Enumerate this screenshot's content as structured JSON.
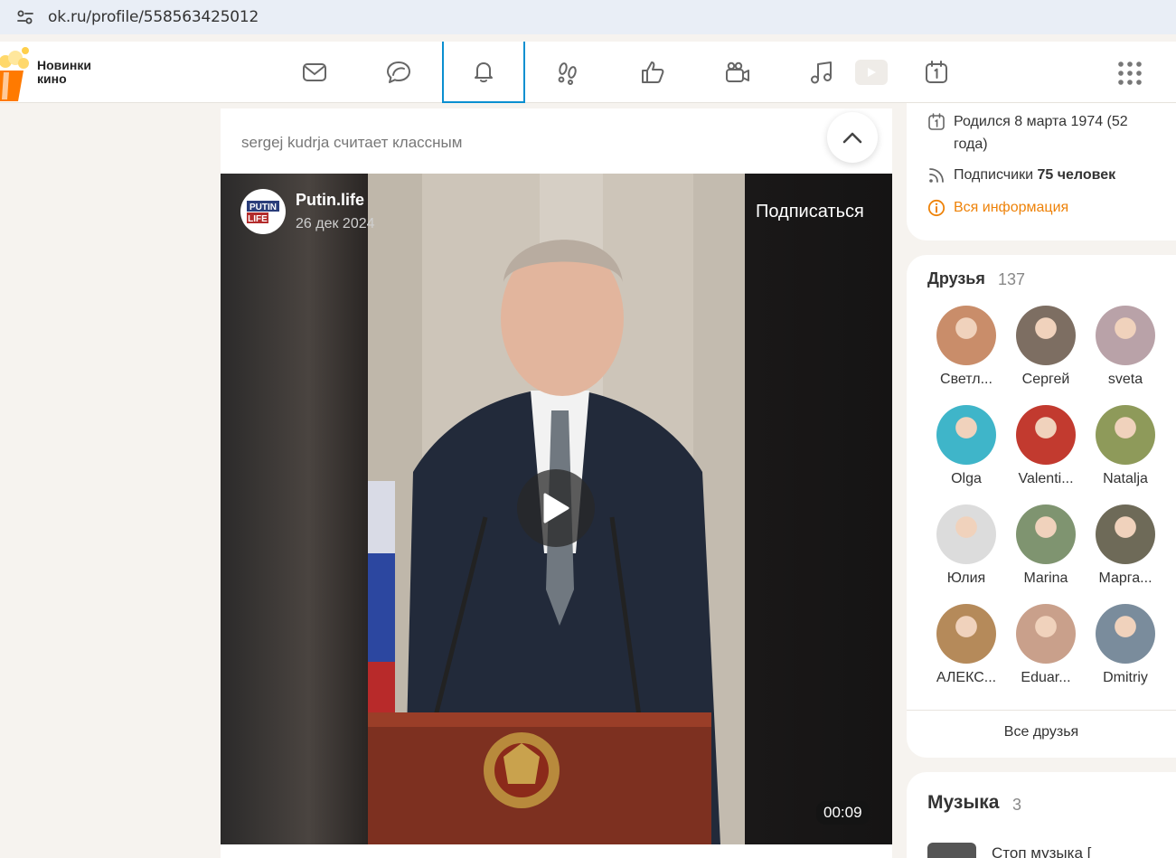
{
  "browser": {
    "url": "ok.ru/profile/558563425012"
  },
  "promo": {
    "text": "Новинки\nкино"
  },
  "nav": {
    "items": [
      {
        "name": "messages-icon"
      },
      {
        "name": "discussions-icon"
      },
      {
        "name": "notifications-icon",
        "active": true
      },
      {
        "name": "guests-icon"
      },
      {
        "name": "events-icon"
      },
      {
        "name": "video-icon"
      },
      {
        "name": "music-icon"
      },
      {
        "name": "calendar-icon"
      }
    ]
  },
  "feed": {
    "liked_by": "sergej kudrja считает классным",
    "post": {
      "channel_name": "Putin.life",
      "date": "26 дек 2024",
      "subscribe_label": "Подписаться",
      "duration": "00:09",
      "watermark": "PUTIN LIFE"
    }
  },
  "profile_info": {
    "birth_label": "Родился 8 марта 1974 (52 года)",
    "subscribers_prefix": "Подписчики",
    "subscribers_value": "75 человек",
    "all_info_label": "Вся информация"
  },
  "friends": {
    "title": "Друзья",
    "count": "137",
    "list": [
      {
        "name": "Светл...",
        "color": "#c98d6a"
      },
      {
        "name": "Сергей",
        "color": "#7d6e62"
      },
      {
        "name": "sveta",
        "color": "#b9a2a8"
      },
      {
        "name": "Olga",
        "color": "#3fb5c9"
      },
      {
        "name": "Valenti...",
        "color": "#c23a2f"
      },
      {
        "name": "Natalja",
        "color": "#8e9a5a"
      },
      {
        "name": "Юлия",
        "color": "#dcdcdc"
      },
      {
        "name": "Marina",
        "color": "#7f9470"
      },
      {
        "name": "Марга...",
        "color": "#6e6a58"
      },
      {
        "name": "АЛЕКС...",
        "color": "#b58a5a"
      },
      {
        "name": "Eduar...",
        "color": "#c9a08b"
      },
      {
        "name": "Dmitriy",
        "color": "#7a8c9c"
      }
    ],
    "all_label": "Все друзья"
  },
  "music": {
    "title": "Музыка",
    "count": "3",
    "first_track": "Стоп музыка ["
  }
}
